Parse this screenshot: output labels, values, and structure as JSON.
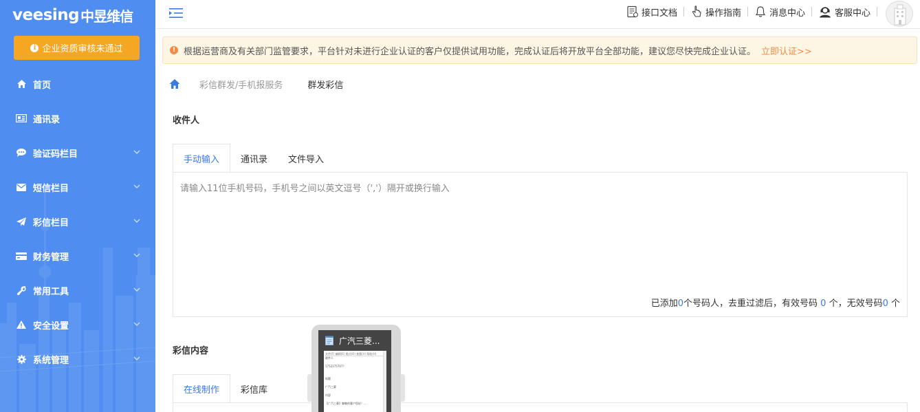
{
  "brand": {
    "logo_text": "veesing",
    "logo_cn": "中昱维信"
  },
  "sidebar": {
    "audit_button": "企业资质审核未通过",
    "items": [
      {
        "label": "首页",
        "icon": "home-icon",
        "has_children": false
      },
      {
        "label": "通讯录",
        "icon": "contacts-icon",
        "has_children": false
      },
      {
        "label": "验证码栏目",
        "icon": "chat-bubble-icon",
        "has_children": true
      },
      {
        "label": "短信栏目",
        "icon": "envelope-icon",
        "has_children": true
      },
      {
        "label": "彩信栏目",
        "icon": "paper-plane-icon",
        "has_children": true
      },
      {
        "label": "财务管理",
        "icon": "credit-card-icon",
        "has_children": true
      },
      {
        "label": "常用工具",
        "icon": "wrench-icon",
        "has_children": true
      },
      {
        "label": "安全设置",
        "icon": "warning-icon",
        "has_children": true
      },
      {
        "label": "系统管理",
        "icon": "gear-icon",
        "has_children": true
      }
    ]
  },
  "header": {
    "links": [
      {
        "label": "接口文档",
        "icon": "api-doc-icon"
      },
      {
        "label": "操作指南",
        "icon": "hand-pointer-icon"
      },
      {
        "label": "消息中心",
        "icon": "bell-icon"
      },
      {
        "label": "客服中心",
        "icon": "customer-service-icon"
      }
    ]
  },
  "notice": {
    "text": "根据运营商及有关部门监管要求，平台针对未进行企业认证的客户仅提供试用功能，完成认证后将开放平台全部功能，建议您尽快完成企业认证。",
    "link": "立即认证>>"
  },
  "breadcrumb": {
    "parent": "彩信群发/手机报服务",
    "current": "群发彩信"
  },
  "recipients": {
    "title": "收件人",
    "tabs": [
      "手动输入",
      "通讯录",
      "文件导入"
    ],
    "active_tab": 0,
    "placeholder": "请输入11位手机号码，手机号之间以英文逗号（','）隔开或换行输入",
    "value": "",
    "stats": {
      "prefix": "已添加",
      "added": "0",
      "mid1": "个号码人，去重过滤后，有效号码",
      "valid": " 0 ",
      "mid2": "个，无效号码",
      "invalid": "0",
      "suffix": " 个"
    }
  },
  "mms_content": {
    "title": "彩信内容",
    "tabs": [
      "在线制作",
      "彩信库"
    ],
    "active_tab": 0
  },
  "preview": {
    "title": "广汽三菱...",
    "doc_lines": [
      "收件人",
      "1752175707?",
      "",
      "标题",
      "广汽三菱",
      "内容",
      "【广汽三菱】尊敬的客户您好！..."
    ],
    "menu": "文件(F) 编辑(E) 格式(O) 查看(V) 帮助(H)"
  }
}
